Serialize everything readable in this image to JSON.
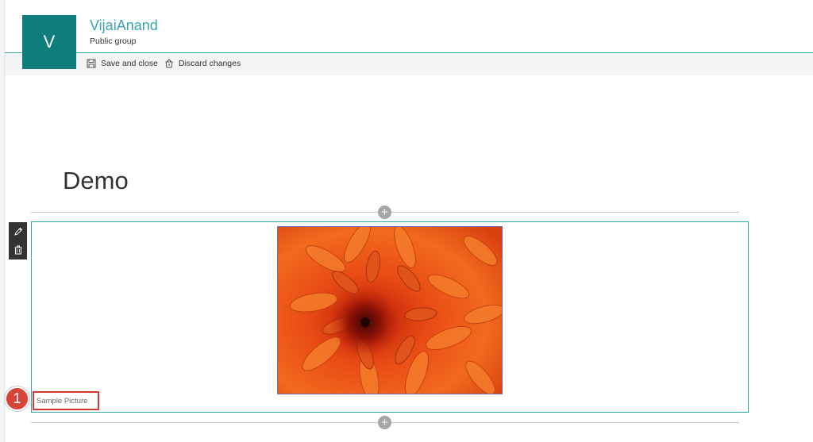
{
  "site": {
    "logo_letter": "V",
    "title": "VijaiAnand",
    "subtitle": "Public group"
  },
  "commandbar": {
    "save_label": "Save and close",
    "discard_label": "Discard changes"
  },
  "page": {
    "title": "Demo"
  },
  "webpart": {
    "caption": "Sample Picture",
    "image_description": "orange chrysanthemum flower"
  },
  "callout": {
    "number": "1"
  },
  "icons": {
    "save": "save-icon",
    "discard": "discard-icon",
    "edit": "pencil-icon",
    "delete": "trash-icon",
    "add": "plus-icon"
  },
  "colors": {
    "accent": "#2aa8a0",
    "logo_bg": "#0f7d7b",
    "title": "#3aa3b8",
    "callout": "#d8433a"
  }
}
